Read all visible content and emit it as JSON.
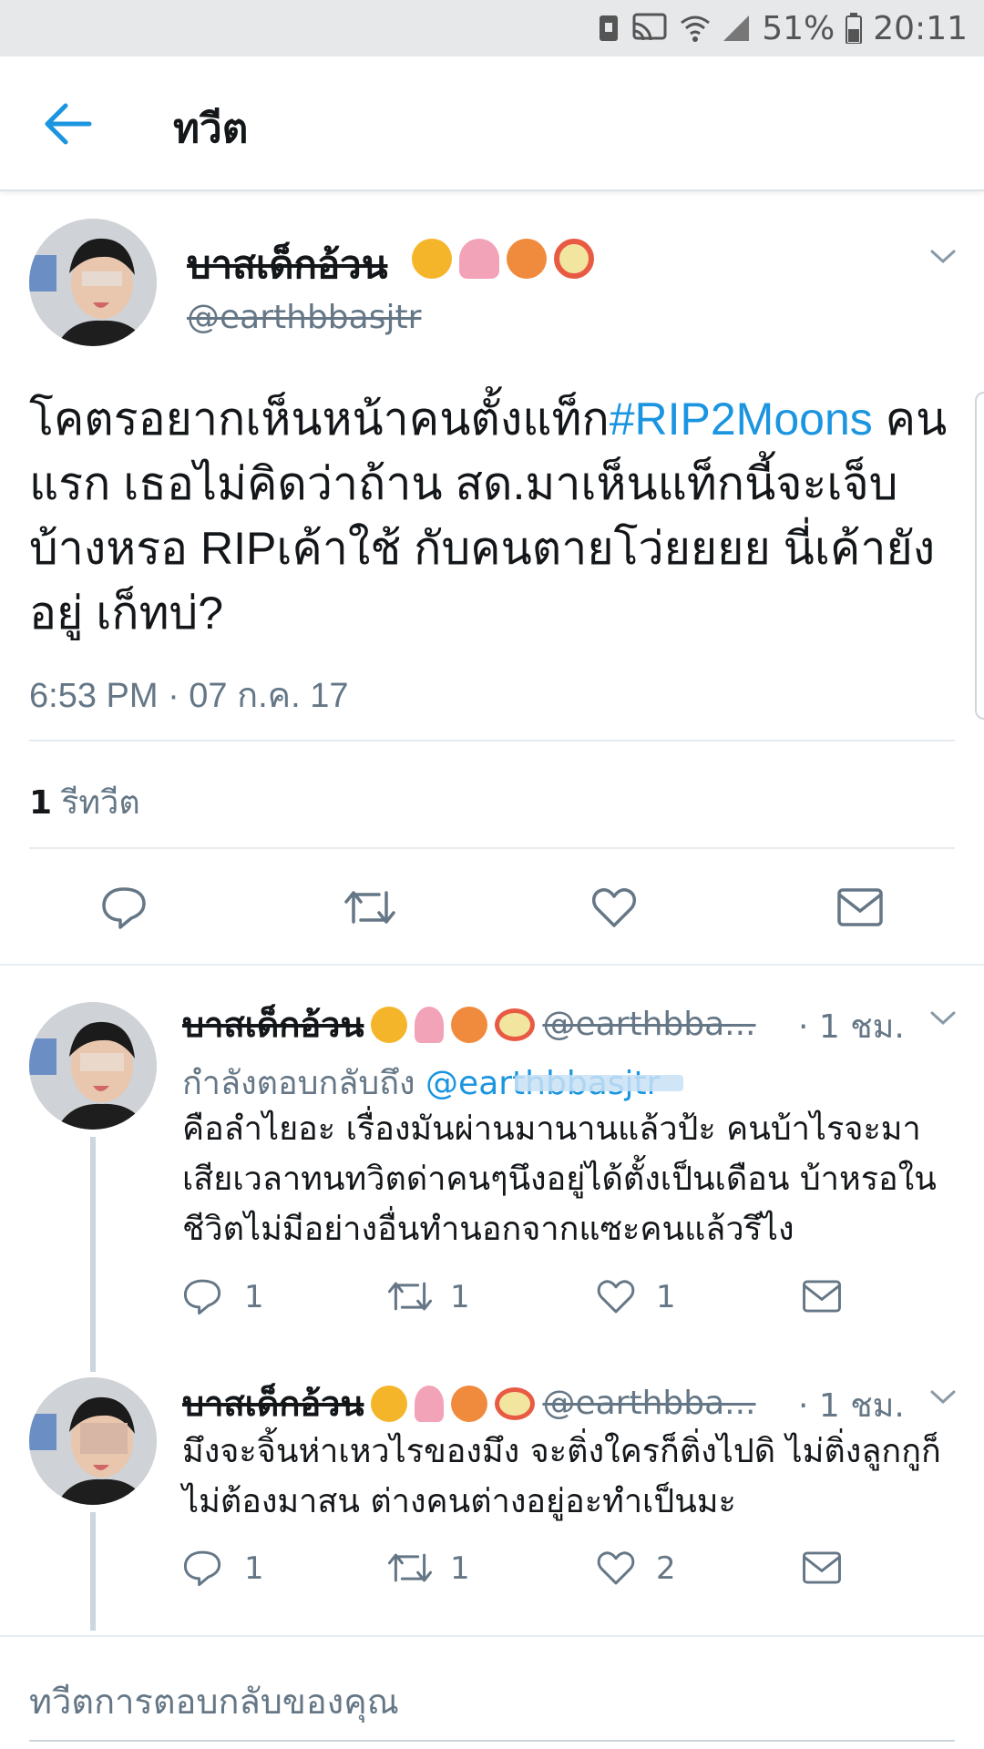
{
  "status_bar": {
    "battery": "51%",
    "time": "20:11"
  },
  "header": {
    "title": "ทวีต"
  },
  "main_tweet": {
    "name": "บาสเด็กอ้วน",
    "handle": "@earthbbasjtr",
    "text_before": "โคตรอยากเห็นหน้าคนตั้งแท็ก",
    "hashtag": "#RIP2Moons",
    "text_after": " คนแรก เธอไม่คิดว่าถ้าน สด.มาเห็นแท็กนี้จะเจ็บบ้างหรอ RIPเค้าใช้ กับคนตายโว่ยยยย นี่เค้ายังอยู่ เก็ทบ่?",
    "timestamp": "6:53 PM · 07 ก.ค. 17",
    "retweet_count": "1",
    "retweet_label": "รีทวีต"
  },
  "replies": [
    {
      "name": "บาสเด็กอ้วน",
      "handle": "@earthbba...",
      "time": "· 1 ชม.",
      "replying_prefix": "กำลังตอบกลับถึง",
      "replying_to": "@earthbbasjtr",
      "text": "คือลำไยอะ เรื่องมันผ่านมานานแล้วป้ะ คนบ้าไรจะมาเสียเวลาทนทวิตด่าคนๆนึงอยู่ได้ตั้งเป็นเดือน บ้าหรอในชีวิตไม่มีอย่างอื่นทำนอกจากแซะคนแล้วรึไง",
      "replies": "1",
      "retweets": "1",
      "likes": "1"
    },
    {
      "name": "บาสเด็กอ้วน",
      "handle": "@earthbba...",
      "time": "· 1 ชม.",
      "text": "มึงจะจิ้นห่าเหวไรของมึง จะติ่งใครก็ติ่งไปดิ ไม่ติ่งลูกกูก็ไม่ต้องมาสน ต่างคนต่างอยู่อะทำเป็นมะ",
      "replies": "1",
      "retweets": "1",
      "likes": "2"
    }
  ],
  "compose": {
    "placeholder": "ทวีตการตอบกลับของคุณ"
  },
  "colors": {
    "accent": "#1b95e0",
    "muted": "#657786",
    "text": "#14171a"
  }
}
